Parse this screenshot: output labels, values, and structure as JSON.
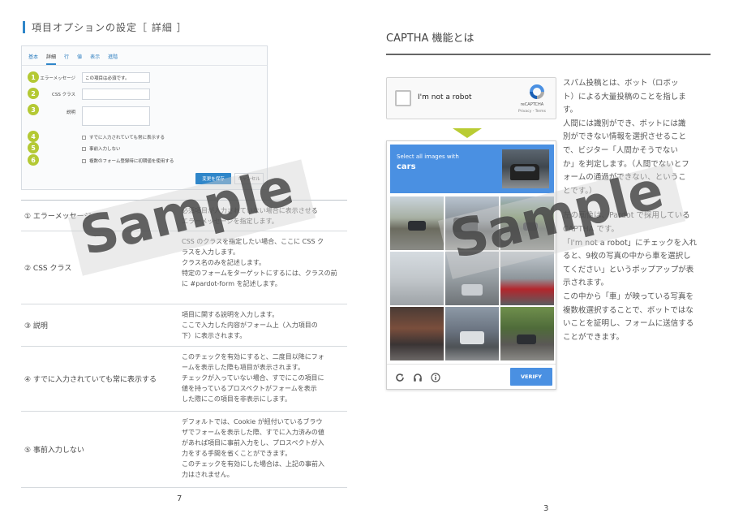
{
  "left_page": {
    "section_title": "項目オプションの設定［ 詳細 ］",
    "form": {
      "tabs": [
        "基本",
        "詳細",
        "⾏",
        "値",
        "表示",
        "進階"
      ],
      "rows": [
        {
          "num": "1",
          "label": "エラーメッセージ",
          "value": "この項目は必須です。"
        },
        {
          "num": "2",
          "label": "CSS クラス",
          "value": ""
        },
        {
          "num": "3",
          "label": "説明",
          "value": ""
        }
      ],
      "checks": [
        {
          "num": "4",
          "label": "すでに入力されていても常に表示する"
        },
        {
          "num": "5",
          "label": "事前入力しない"
        },
        {
          "num": "6",
          "label": "複数のフォーム登録時に初期値を使用する"
        }
      ],
      "save_label": "変更を保存",
      "cancel_label": "キャンセル"
    },
    "table": [
      {
        "name": "① エラーメッセージ",
        "desc": [
          "必須項目が入力されていない場合に表示させる",
          "エラーメッセージを指定します。"
        ]
      },
      {
        "name": "② CSS クラス",
        "desc": [
          "CSS のクラスを指定したい場合、ここに CSS ク",
          "ラスを入力します。",
          "クラス名のみを記述します。",
          "特定のフォームをターゲットにするには、クラスの前",
          "に #pardot-form を記述します。"
        ]
      },
      {
        "name": "③ 説明",
        "desc": [
          "項目に関する説明を入力します。",
          "ここで入力した内容がフォーム上（入力項目の",
          "下）に表示されます。"
        ]
      },
      {
        "name": "④ すでに入力されていても常に表示する",
        "desc": [
          "このチェックを有効にすると、二度目以降にフォ",
          "ームを表示した際も項目が表示されます。",
          "チェックが入っていない場合、すでにこの項目に",
          "値を持っているプロスペクトがフォームを表示",
          "した際にこの項目を非表示にします。"
        ]
      },
      {
        "name": "⑤ 事前入力しない",
        "desc": [
          "デフォルトでは、Cookie が紐付いているブラウ",
          "ザでフォームを表示した際、すでに入力済みの値",
          "があれば項目に事前入力をし、プロスペクトが入",
          "力をする手間を省くことができます。",
          "このチェックを有効にした場合は、上記の事前入",
          "力はされません。"
        ]
      }
    ],
    "page_number": "7",
    "watermark": "Sample"
  },
  "right_page": {
    "title": "CAPTHA 機能とは",
    "recaptcha": {
      "checkbox_label": "I'm not a robot",
      "brand": "reCAPTCHA",
      "terms": "Privacy - Terms"
    },
    "challenge": {
      "instruction": "Select all images with",
      "target": "cars",
      "verify_label": "VERIFY",
      "icons": [
        "reload-icon",
        "headphones-icon",
        "info-icon"
      ]
    },
    "description": [
      [
        "スパム投稿とは、ボット（ロボッ",
        "ト）による大量投稿のことを指しま",
        "す。",
        "人間には識別ができ、ボットには識",
        "別ができない情報を選択させること",
        "で、ビジター「人間かそうでない",
        "か」を判定します。（人間でないとフ",
        "ォームの通過ができない、というこ",
        "とです。）"
      ],
      [
        "左の画像は、Pardot で採用している",
        "CAPTHA です。",
        "「I'm not a robot」にチェックを入れ",
        "ると、9枚の写真の中から車を選択し",
        "てください」というポップアップが表",
        "示されます。",
        "この中から「車」が映っている写真を",
        "複数枚選択することで、ボットではな",
        "いことを証明し、フォームに送信する",
        "ことができます。"
      ]
    ],
    "page_number": "3",
    "watermark": "Sample"
  }
}
